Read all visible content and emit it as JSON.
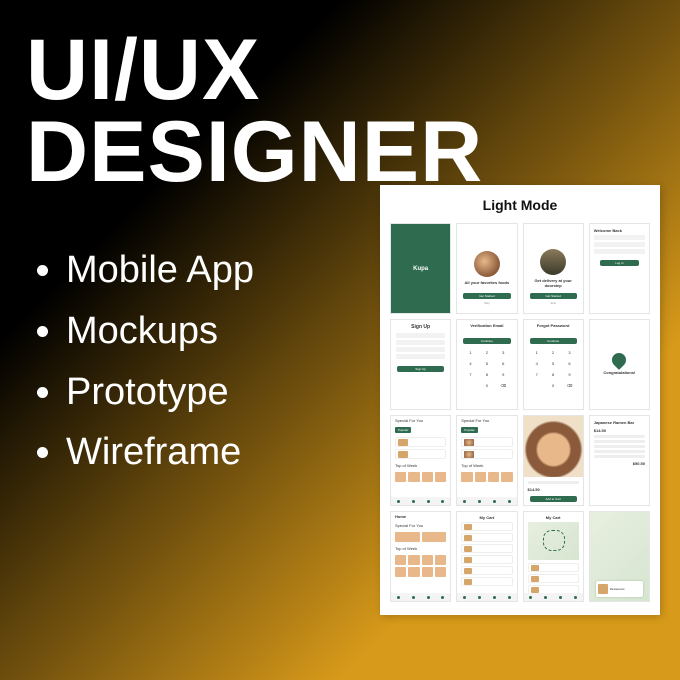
{
  "heading": {
    "line1": "UI/UX",
    "line2": "DESIGNER"
  },
  "bullets": [
    "Mobile App",
    "Mockups",
    "Prototype",
    "Wireframe"
  ],
  "panel": {
    "title": "Light Mode"
  },
  "screens": {
    "s1": "Kupa",
    "s2": {
      "title": "All your\nfavorites foods",
      "btn": "Get Started",
      "skip": "Skip"
    },
    "s3": {
      "title": "Get delivery at your\ndoorstep",
      "btn": "Get Started",
      "skip": "Skip"
    },
    "s4": {
      "title": "Welcome Back",
      "btn": "Log In"
    },
    "s5": {
      "title": "Sign Up",
      "btn": "Sign Up"
    },
    "s6": {
      "title": "Verification Email",
      "btn": "Continue"
    },
    "s7": {
      "title": "Forgot Password",
      "btn": "Continue"
    },
    "s8": {
      "title": "Congratulations!"
    },
    "s9": {
      "title": "Special For You",
      "badge": "Popular",
      "sec": "Top of Week"
    },
    "s10": {
      "title": "Special For You",
      "badge": "Popular",
      "sec": "Top of Week"
    },
    "s11": {
      "price": "$14.50",
      "btn": "Add to Cart"
    },
    "s12": {
      "title": "Japanese Ramen Bar",
      "price": "$14.50",
      "total": "$50.50"
    },
    "s13": {
      "title": "Home",
      "sec": "Special For You",
      "sec2": "Top of Week"
    },
    "s14": {
      "title": "My Cart"
    },
    "s15": {
      "title": "My Cart"
    },
    "s16": {
      "place": "Restaurant"
    }
  }
}
